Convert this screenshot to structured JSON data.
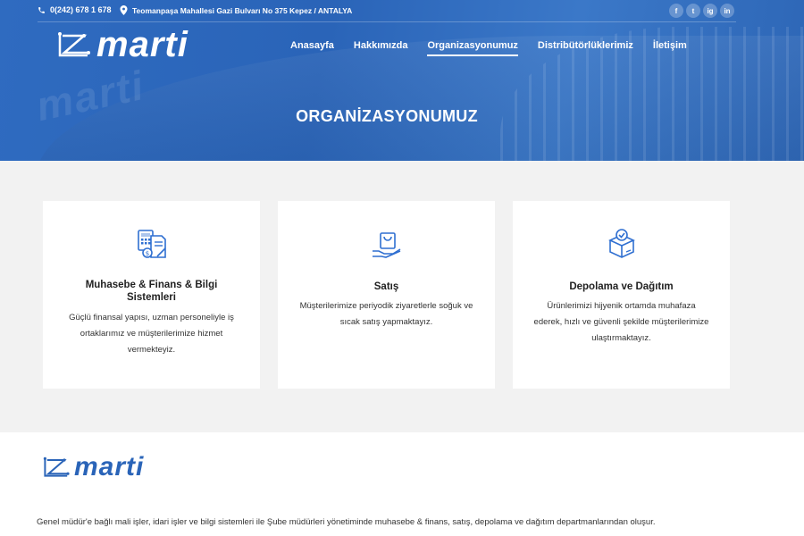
{
  "topbar": {
    "phone": "0(242) 678 1 678",
    "address": "Teomanpaşa Mahallesi Gazi Bulvarı No 375 Kepez / ANTALYA",
    "social": [
      "f",
      "t",
      "ig",
      "in"
    ]
  },
  "brand": {
    "name": "marti"
  },
  "nav": {
    "items": [
      "Anasayfa",
      "Hakkımızda",
      "Organizasyonumuz",
      "Distribütörlüklerimiz",
      "İletişim"
    ],
    "active_index": 2
  },
  "hero": {
    "title": "ORGANİZASYONUMUZ"
  },
  "cards": [
    {
      "icon": "accounting-calculator-icon",
      "title": "Muhasebe & Finans & Bilgi Sistemleri",
      "text": "Güçlü finansal yapısı, uzman personeliyle iş ortaklarımız ve müşterilerimize hizmet vermekteyiz."
    },
    {
      "icon": "shopping-bag-hand-icon",
      "title": "Satış",
      "text": "Müşterilerimize periyodik ziyaretlerle soğuk ve sıcak satış yapmaktayız."
    },
    {
      "icon": "package-box-icon",
      "title": "Depolama ve Dağıtım",
      "text": "Ürünlerimizi hijyenik ortamda muhafaza ederek, hızlı ve güvenli şekilde müşterilerimize ulaştırmaktayız."
    }
  ],
  "footer": {
    "description": "Genel müdür'e bağlı mali işler, idari işler ve bilgi sistemleri ile Şube müdürleri yönetiminde muhasebe & finans, satış, depolama ve dağıtım departmanlarından oluşur."
  },
  "colors": {
    "brand_blue": "#2a64b8",
    "icon_blue": "#2f6fd1",
    "card_bg": "#ffffff",
    "section_bg": "#f2f2f2"
  }
}
